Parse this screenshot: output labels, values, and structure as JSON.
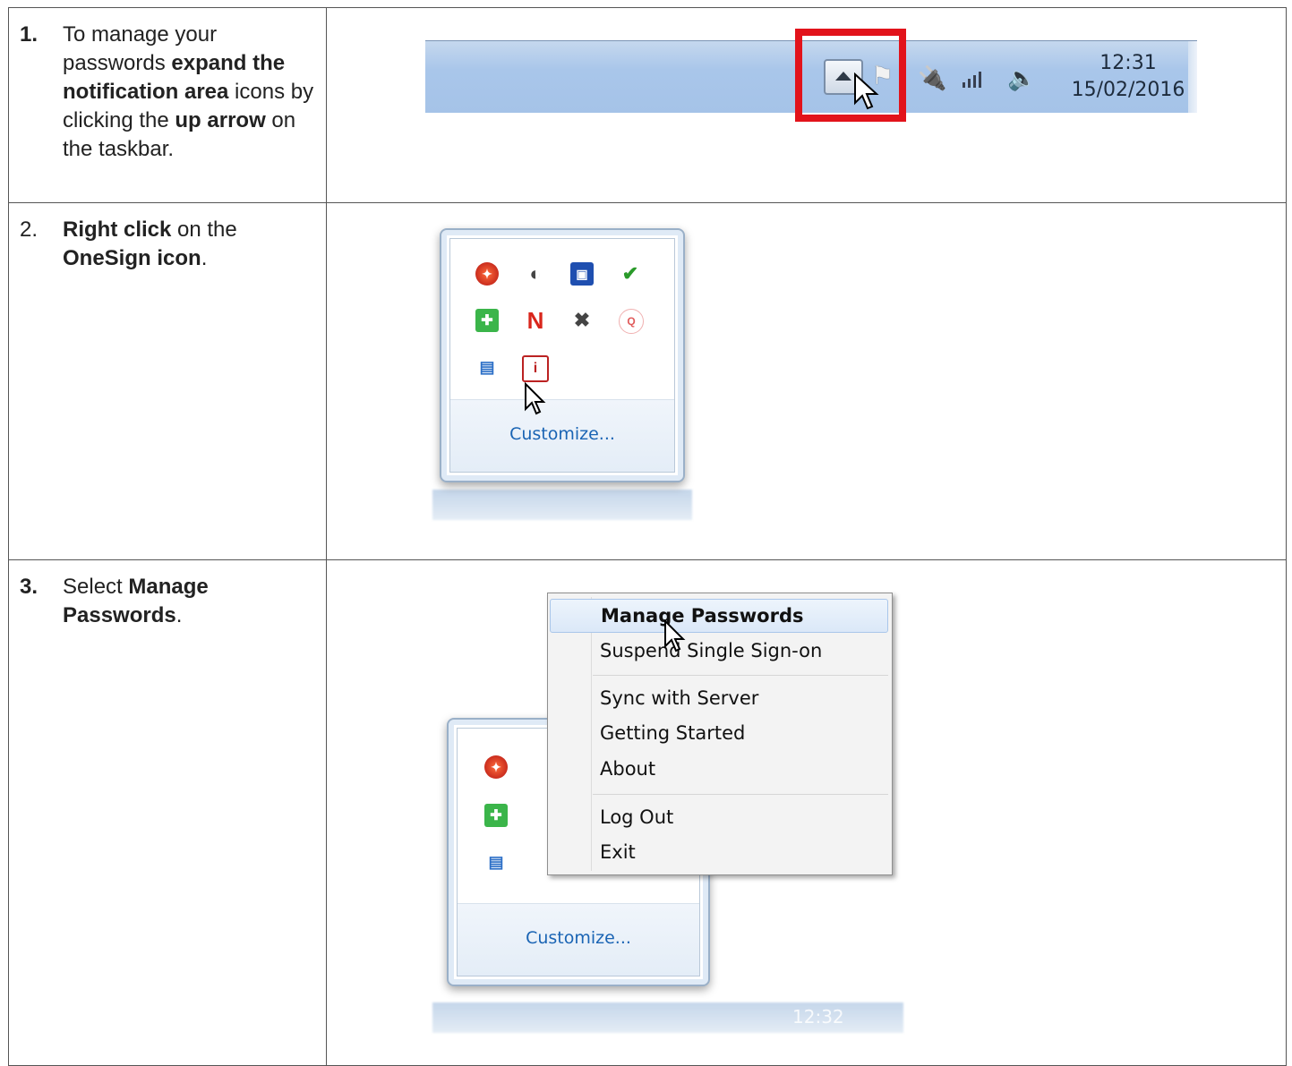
{
  "steps": [
    {
      "number": "1.",
      "parts": [
        "To manage your passwords ",
        "expand the notification area",
        " icons by clicking the ",
        "up arrow",
        " on the taskbar."
      ]
    },
    {
      "number": "2.",
      "parts": [
        "Right click",
        " on the ",
        "OneSign icon",
        "."
      ]
    },
    {
      "number": "3.",
      "parts": [
        "Select ",
        "Manage Passwords",
        "."
      ]
    }
  ],
  "taskbar": {
    "time": "12:31",
    "date": "15/02/2016",
    "highlight_color": "#e2131b"
  },
  "tray": {
    "customize_label": "Customize...",
    "icons": [
      "red-shield-icon",
      "color-wheel-icon",
      "monitor-icon",
      "power-plug-icon",
      "green-shield-icon",
      "n-letter-icon",
      "network-error-icon",
      "red-circle-icon",
      "network-computers-icon",
      "onesign-icon"
    ]
  },
  "menu": {
    "items": [
      "Manage Passwords",
      "Suspend Single Sign-on",
      "Sync with Server",
      "Getting Started",
      "About",
      "Log Out",
      "Exit"
    ],
    "customize_label": "Customize...",
    "bg_time": "12:32"
  }
}
